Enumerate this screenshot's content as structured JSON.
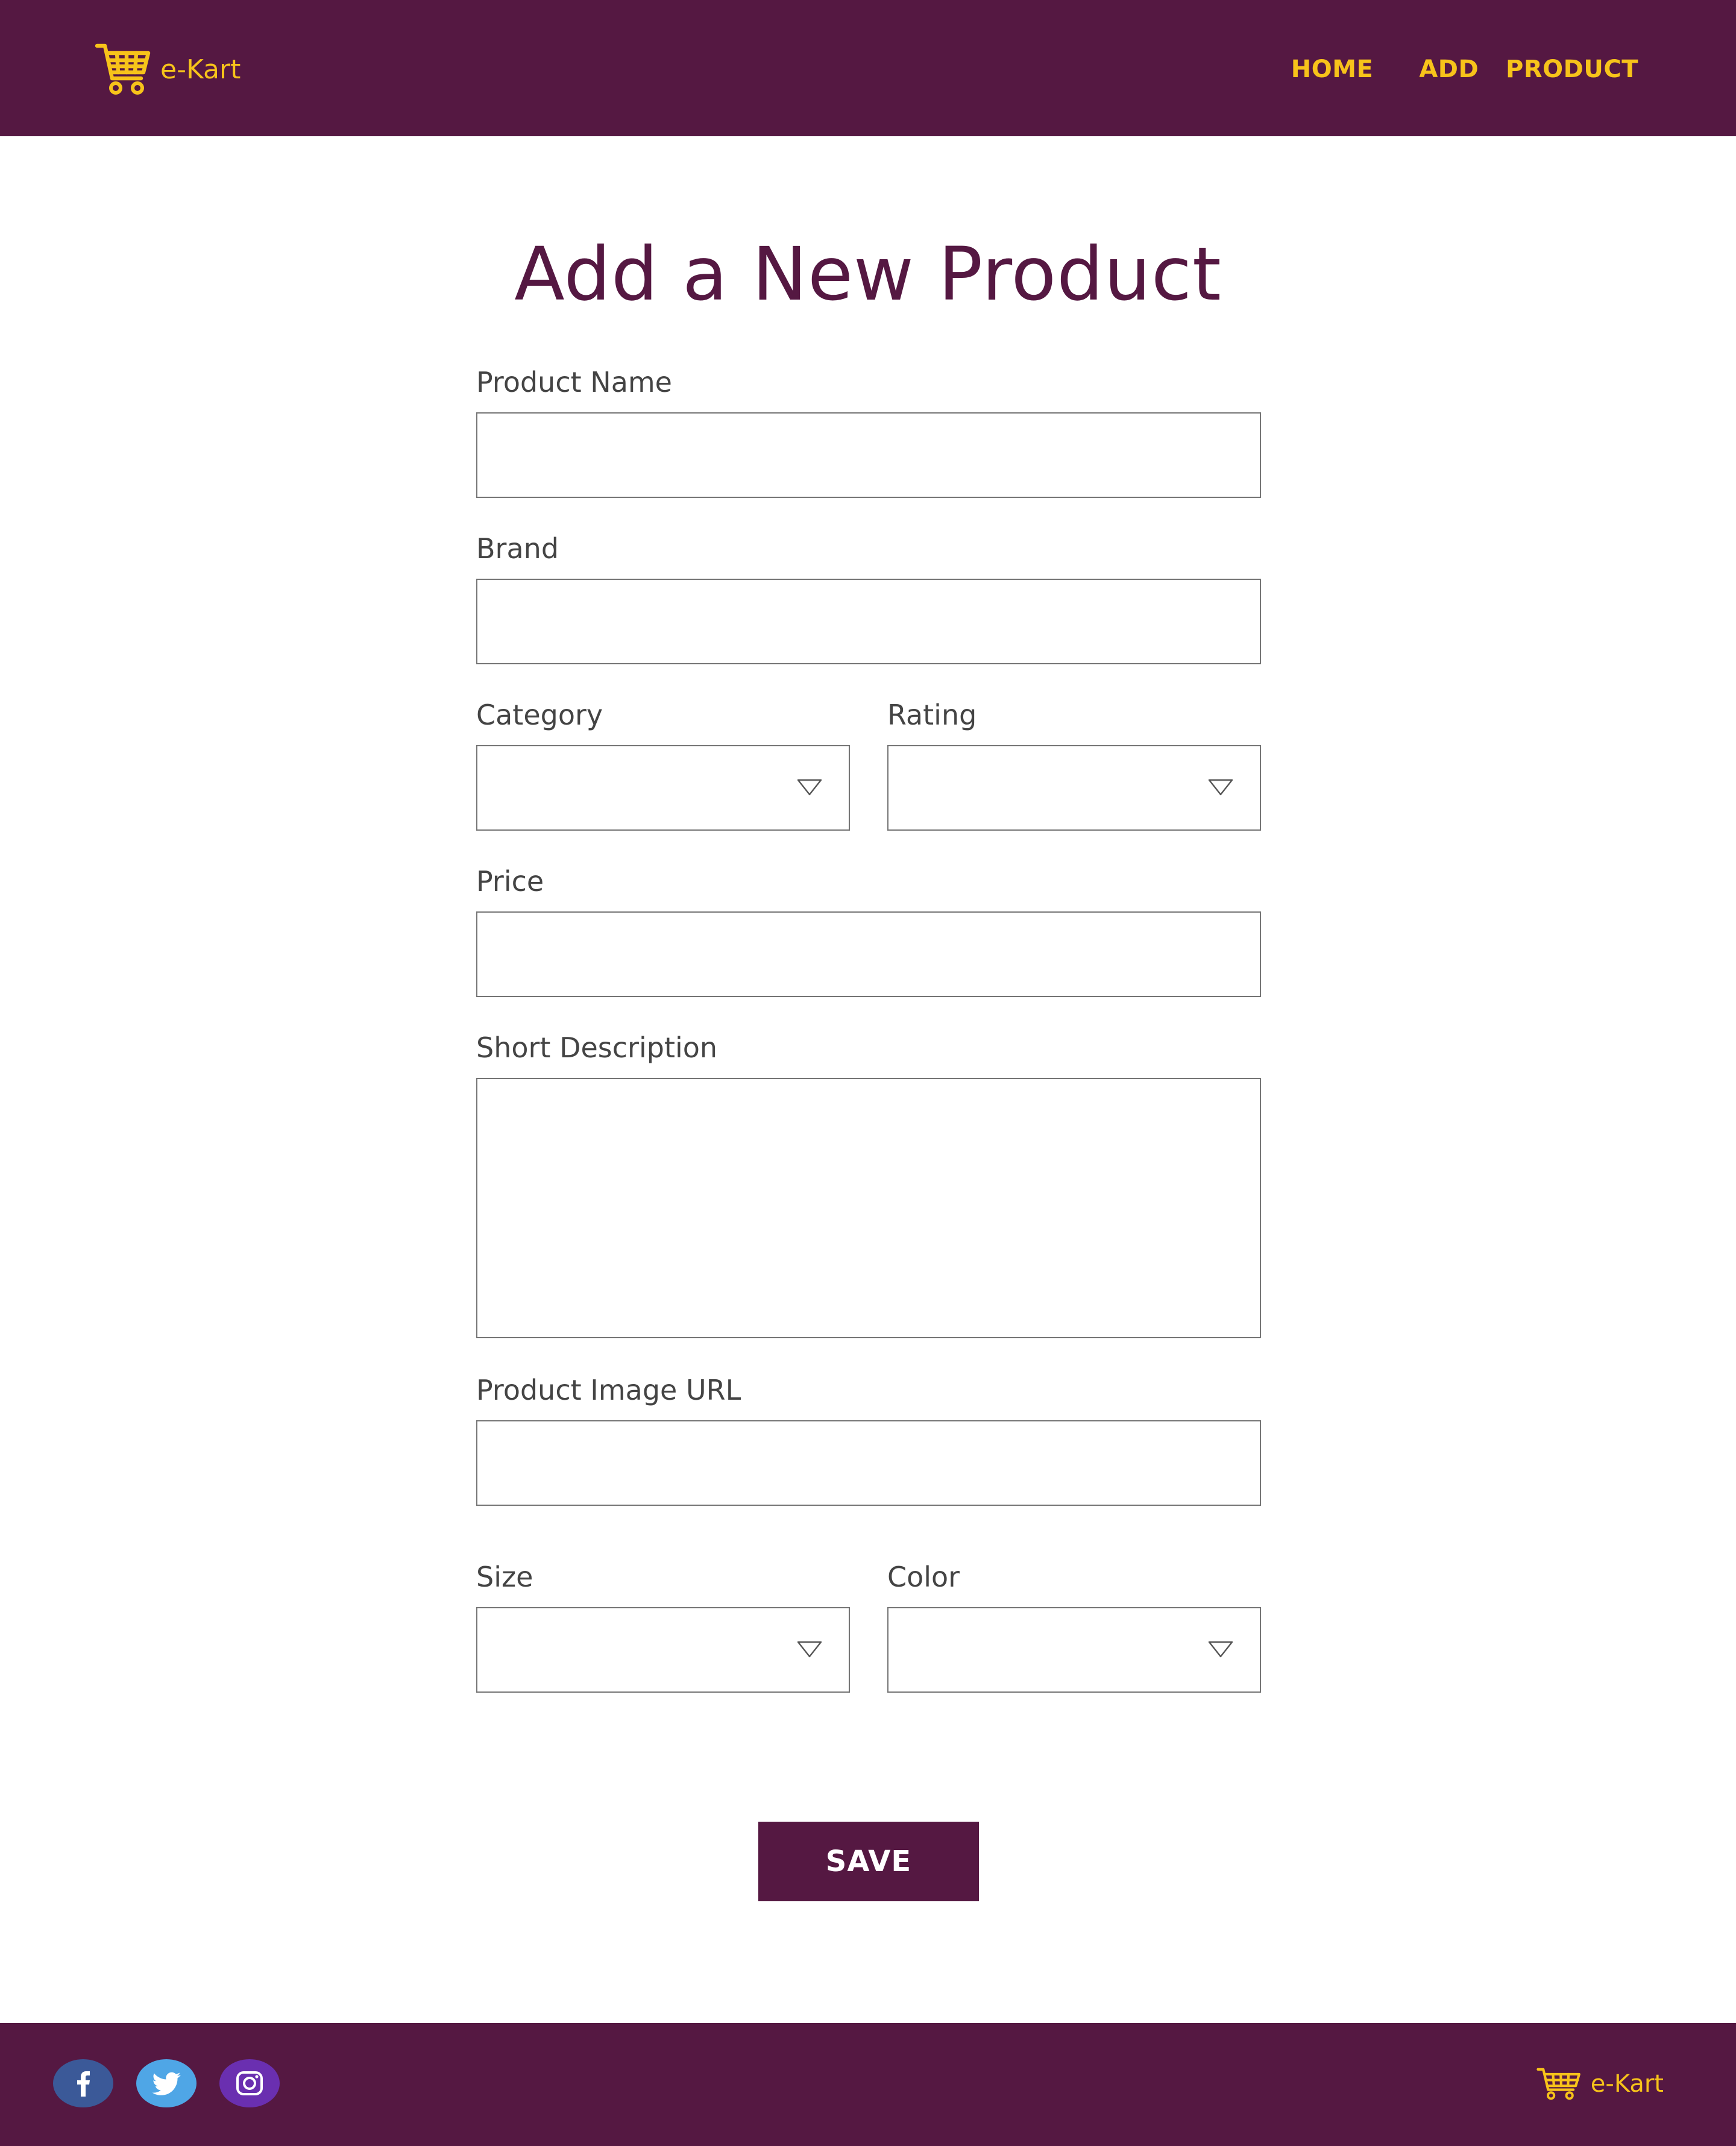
{
  "header": {
    "brand": "e-Kart",
    "nav": {
      "home": "HOME",
      "add_product": "ADD  PRODUCT"
    }
  },
  "page": {
    "title": "Add a New Product"
  },
  "form": {
    "product_name": {
      "label": "Product Name",
      "value": ""
    },
    "brand": {
      "label": "Brand",
      "value": ""
    },
    "category": {
      "label": "Category",
      "value": ""
    },
    "rating": {
      "label": "Rating",
      "value": ""
    },
    "price": {
      "label": "Price",
      "value": ""
    },
    "short_description": {
      "label": "Short Description",
      "value": ""
    },
    "image_url": {
      "label": "Product Image URL",
      "value": ""
    },
    "size": {
      "label": "Size",
      "value": ""
    },
    "color": {
      "label": "Color",
      "value": ""
    },
    "save_label": "SAVE"
  },
  "footer": {
    "brand": "e-Kart",
    "social": [
      "facebook-icon",
      "twitter-icon",
      "instagram-icon"
    ]
  },
  "colors": {
    "brand_purple": "#551842",
    "accent_yellow": "#f7c31a",
    "facebook": "#3b5998",
    "twitter": "#4fa6e6",
    "instagram": "#6a2fb0"
  }
}
